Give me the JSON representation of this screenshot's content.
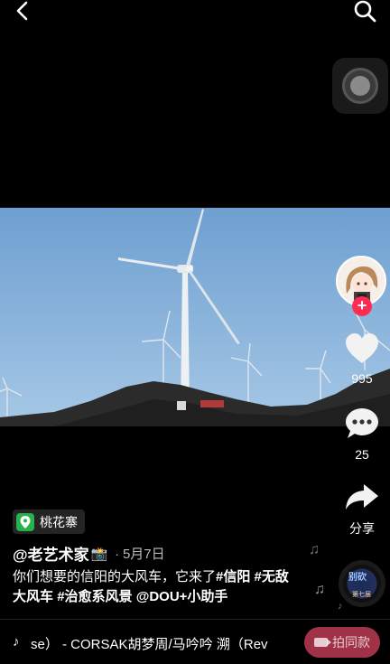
{
  "top_bar": {
    "back_icon": "chevron-left-icon",
    "search_icon": "search-icon"
  },
  "floating_ball": {
    "icon": "assistive-ball-icon"
  },
  "video": {
    "scene": "wind-turbines",
    "sky_color": "#7eaed8"
  },
  "side_actions": {
    "avatar_icon": "avatar",
    "follow_label": "+",
    "like_count": "995",
    "comment_count": "25",
    "share_label": "分享"
  },
  "location": {
    "name": "桃花寨",
    "icon": "location-pin-icon",
    "color": "#26b24a"
  },
  "author": {
    "name": "@老艺术家",
    "emoji": "📸",
    "separator": "·",
    "date": "5月7日"
  },
  "caption": {
    "text": "你们想要的信阳的大风车，它来了",
    "tags": [
      "#信阳",
      "#无敌大风车",
      "#治愈系风景",
      "@DOU+小助手"
    ]
  },
  "music": {
    "prefix_icon": "♪",
    "title": "se） - CORSAK胡梦周/马吟吟   溯（Rev",
    "disc_text_line1": "别砍",
    "disc_text_line2": "第七届",
    "shoot_same_label": "拍同款",
    "accent": "#fe2c55"
  }
}
